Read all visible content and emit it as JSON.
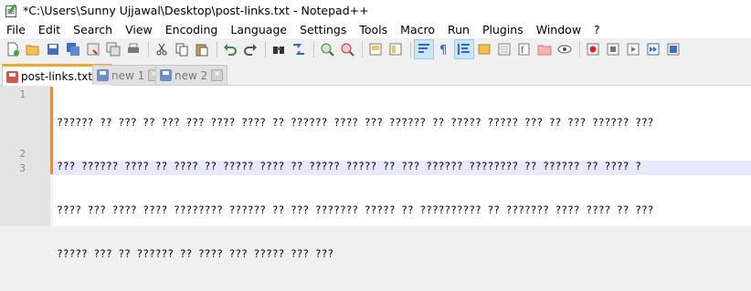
{
  "window": {
    "title": "*C:\\Users\\Sunny Ujjawal\\Desktop\\post-links.txt - Notepad++"
  },
  "menu": [
    "File",
    "Edit",
    "Search",
    "View",
    "Encoding",
    "Language",
    "Settings",
    "Tools",
    "Macro",
    "Run",
    "Plugins",
    "Window",
    "?"
  ],
  "toolbar": {
    "icons": [
      "new-file-icon",
      "open-file-icon",
      "save-icon",
      "save-all-icon",
      "close-icon",
      "close-all-icon",
      "print-icon",
      "cut-icon",
      "copy-icon",
      "paste-icon",
      "undo-icon",
      "redo-icon",
      "find-icon",
      "replace-icon",
      "zoom-in-icon",
      "zoom-out-icon",
      "sync-vertical-icon",
      "sync-horizontal-icon",
      "word-wrap-icon",
      "show-all-characters-icon",
      "indent-guide-icon",
      "udl-icon",
      "doc-map-icon",
      "function-list-icon",
      "folder-workspace-icon",
      "monitoring-icon",
      "record-macro-icon",
      "stop-recording-icon",
      "play-macro-icon",
      "run-macro-multiple-icon",
      "save-macro-icon"
    ]
  },
  "tabs": [
    {
      "label": "post-links.txt",
      "active": true,
      "color": "#d9534f"
    },
    {
      "label": "new 1",
      "active": false,
      "color": "#6d8fc9"
    },
    {
      "label": "new 2",
      "active": false,
      "color": "#6d8fc9"
    }
  ],
  "editor": {
    "line_numbers": [
      "1",
      "2",
      "3"
    ],
    "lines": [
      "?????? ?? ??? ?? ??? ??? ???? ???? ?? ?????? ???? ??? ?????? ?? ????? ????? ??? ?? ??? ?????? ???",
      "??? ?????? ???? ?? ???? ?? ????? ???? ?? ????? ????? ?? ??? ?????? ???????? ?? ?????? ?? ???? ?",
      "???? ??? ???? ???? ???????? ?????? ?? ??? ??????? ????? ?? ?????????? ?? ??????? ???? ???? ?? ???",
      "????? ??? ?? ?????? ?? ???? ??? ????? ??? ???"
    ]
  }
}
